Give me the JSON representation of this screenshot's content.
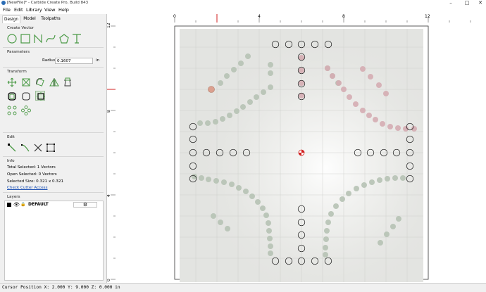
{
  "window": {
    "title": "[NewFile]* - Carbide Create Pro, Build 843",
    "minimize": "–",
    "maximize": "□",
    "close": "✕"
  },
  "menu": [
    {
      "label": "File"
    },
    {
      "label": "Edit"
    },
    {
      "label": "Library"
    },
    {
      "label": "View"
    },
    {
      "label": "Help"
    }
  ],
  "tabs": [
    {
      "label": "Design",
      "active": true
    },
    {
      "label": "Model",
      "active": false
    },
    {
      "label": "Toolpaths",
      "active": false
    }
  ],
  "sections": {
    "create_vector": "Create Vector",
    "parameters": "Parameters",
    "transform": "Transform",
    "edit": "Edit",
    "info": "Info",
    "layers": "Layers"
  },
  "parameters": {
    "radius_label": "Radius",
    "radius_value": "0.1607",
    "radius_unit": "in"
  },
  "info": {
    "total_selected": "Total Selected:  1 Vectors",
    "open_selected": "Open Selected:  0 Vectors",
    "selected_size": "Selected Size:   0.321 x 0.321",
    "check_cutter_link": "Check Cutter Access"
  },
  "layers": [
    {
      "name": "DEFAULT",
      "color": "#000000"
    }
  ],
  "add_layer_label": "+",
  "ruler": {
    "top_labels": [
      "0",
      "4",
      "8",
      "12"
    ],
    "left_labels": [
      "12",
      "8",
      "4",
      "0"
    ]
  },
  "status": {
    "cursor": "Cursor Position X: 2.000 Y: 9.000 Z: 0.000 in"
  },
  "colors": {
    "accent_green": "#4b9a46",
    "panel_bg": "#f0f0f0",
    "selection_red": "#d22020"
  }
}
